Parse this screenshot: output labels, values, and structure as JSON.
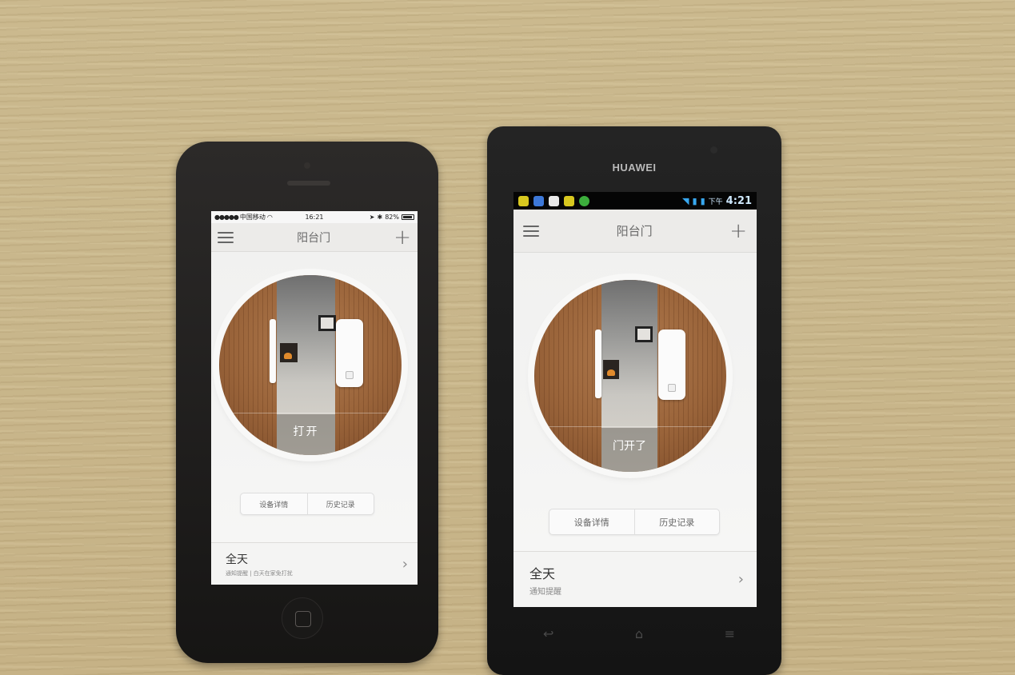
{
  "iphone": {
    "status_bar": {
      "carrier": "中国移动",
      "time": "16:21",
      "battery": "82%"
    },
    "nav": {
      "title": "阳台门"
    },
    "device": {
      "state_label": "打开"
    },
    "tabs": {
      "details": "设备详情",
      "history": "历史记录"
    },
    "rule": {
      "title": "全天",
      "subtitle": "通知提醒 | 白天在家免打扰"
    }
  },
  "android": {
    "brand": "HUAWEI",
    "status_bar": {
      "ampm": "下午",
      "time": "4:21"
    },
    "nav": {
      "title": "阳台门"
    },
    "device": {
      "state_label": "门开了"
    },
    "tabs": {
      "details": "设备详情",
      "history": "历史记录"
    },
    "rule": {
      "title": "全天",
      "subtitle": "通知提醒"
    }
  },
  "icons": {
    "menu": "menu-icon",
    "add": "plus-icon",
    "chevron": "chevron-right-icon",
    "wifi": "wifi-icon",
    "battery": "battery-icon"
  },
  "colors": {
    "wood": "#9a643a",
    "nav_bg": "#ecebe9",
    "screen_bg": "#f1f1f0",
    "status_label_bg": "#6e6962"
  }
}
